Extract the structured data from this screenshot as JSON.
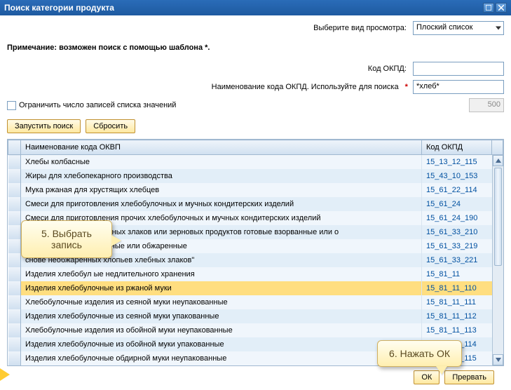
{
  "title": "Поиск категории продукта",
  "view": {
    "label": "Выберите вид просмотра:",
    "value": "Плоский список"
  },
  "note": "Примечание: возможен поиск с помощью шаблона *.",
  "fields": {
    "code_label": "Код ОКПД:",
    "code_value": "",
    "name_label": "Наименование кода ОКПД. Используйте для поиска",
    "name_value": "*хлеб*"
  },
  "limit": {
    "label": "Ограничить число записей списка значений",
    "value": "500"
  },
  "buttons": {
    "search": "Запустить поиск",
    "reset": "Сбросить",
    "ok": "ОК",
    "cancel": "Прервать"
  },
  "columns": {
    "name": "Наименование кода ОКВП",
    "code": "Код ОКПД"
  },
  "rows": [
    {
      "name": "Хлебы колбасные",
      "code": "15_13_12_115"
    },
    {
      "name": "Жиры для хлебопекарного производства",
      "code": "15_43_10_153"
    },
    {
      "name": "Мука ржаная для хрустящих хлебцев",
      "code": "15_61_22_114"
    },
    {
      "name": "Смеси для приготовления хлебобулочных и мучных кондитерских изделий",
      "code": "15_61_24"
    },
    {
      "name": "Смеси для приготовления прочих хлебобулочных и мучных кондитерских изделий",
      "code": "15_61_24_190"
    },
    {
      "name": "Продукты из зерна хлебных злаков или зерновых продуктов готовые взорванные или о",
      "code": "15_61_33_210"
    },
    {
      "name": "                                       злаков готовые взорванные или обжаренные",
      "code": "15_61_33_219"
    },
    {
      "name": "                                       снове необжаренных хлопьев хлебных злаков\"",
      "code": "15_61_33_221"
    },
    {
      "name": "Изделия хлебобул         ые недлительного хранения",
      "code": "15_81_11"
    },
    {
      "name": "Изделия хлебобулочные из ржаной муки",
      "code": "15_81_11_110",
      "selected": true
    },
    {
      "name": "Хлебобулочные изделия из сеяной муки неупакованные",
      "code": "15_81_11_111"
    },
    {
      "name": "Изделия хлебобулочные из сеяной муки упакованные",
      "code": "15_81_11_112"
    },
    {
      "name": "Хлебобулочные изделия из обойной муки неупакованные",
      "code": "15_81_11_113"
    },
    {
      "name": "Изделия хлебобулочные из обойной муки упакованные",
      "code": "15_81_11_114"
    },
    {
      "name": "Изделия хлебобулочные обдирной муки неупакованные",
      "code": "15_81_11_115"
    }
  ],
  "callouts": {
    "c1_line1": "5. Выбрать",
    "c1_line2": "запись",
    "c2": "6. Нажать ОК"
  }
}
